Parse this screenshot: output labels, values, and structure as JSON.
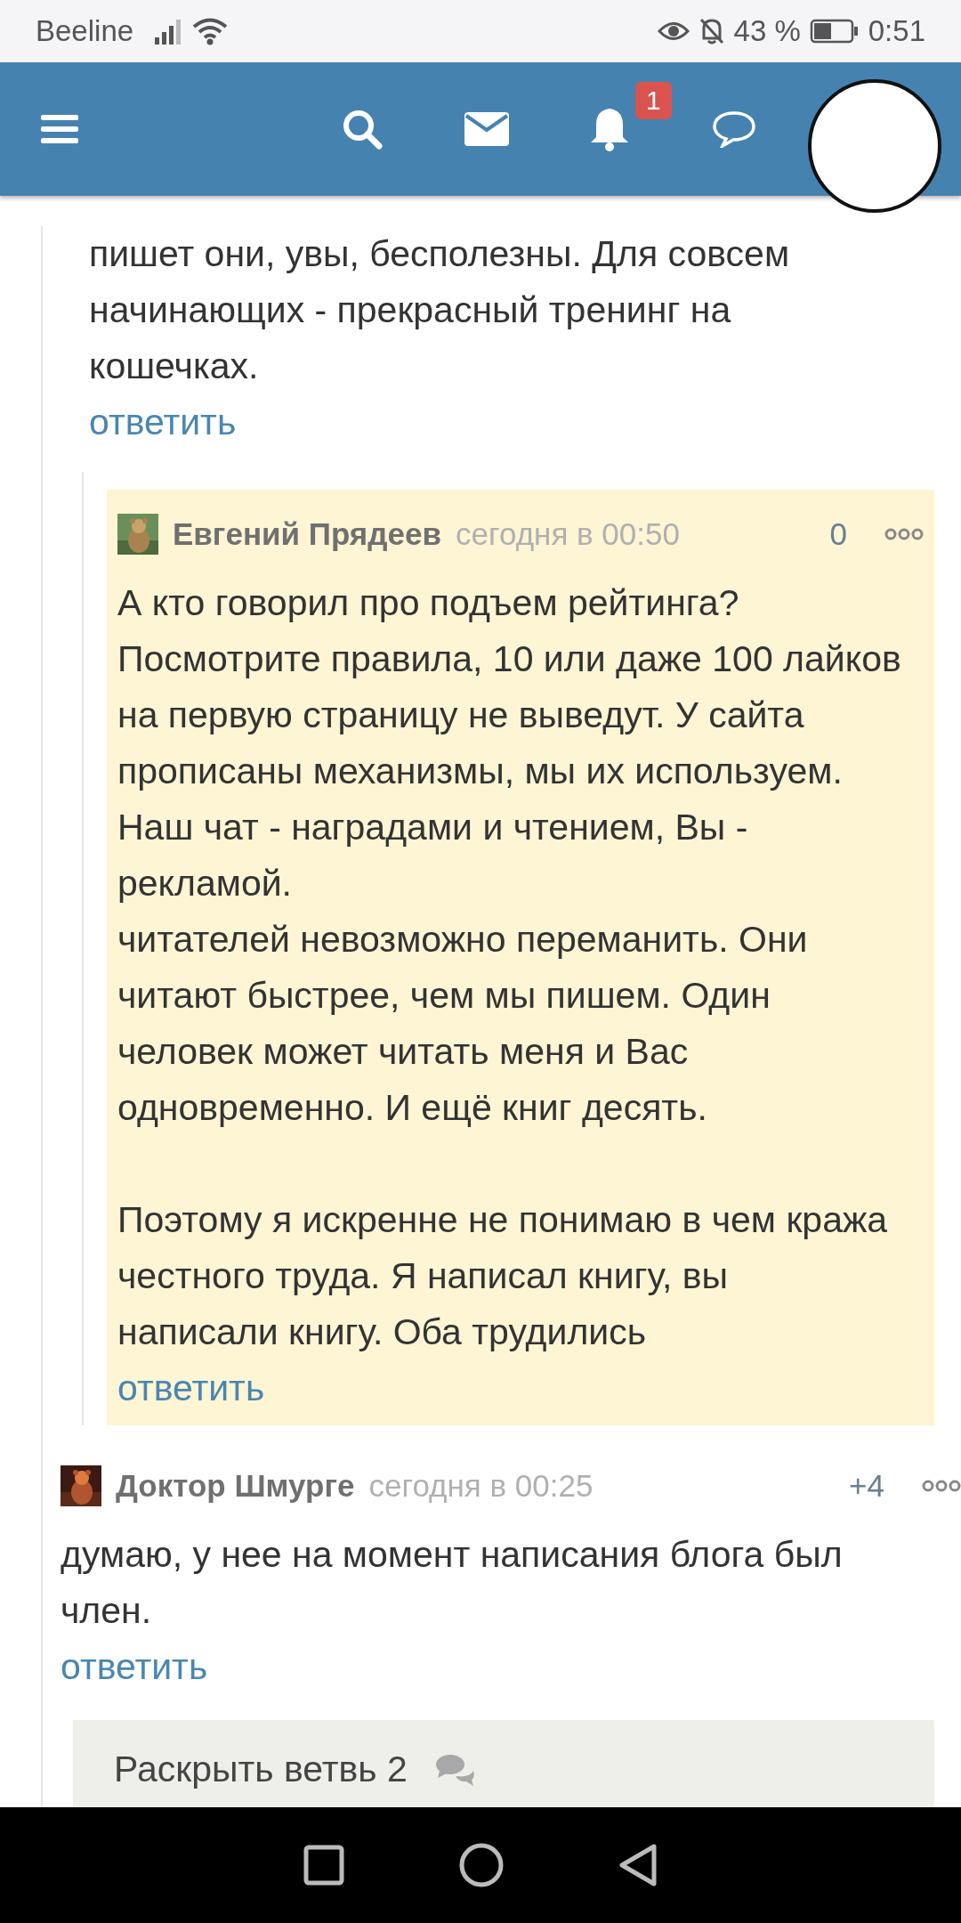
{
  "status_bar": {
    "carrier": "Beeline",
    "battery": "43 %",
    "time": "0:51"
  },
  "header": {
    "notification_count": "1"
  },
  "comments": [
    {
      "body": "пишет они, увы, бесполезны. Для совсем\nначинающих - прекрасный тренинг на\nкошечках.",
      "reply": "ответить",
      "highlighted": false,
      "children": [
        {
          "author": "Евгений Прядеев",
          "time": "сегодня в 00:50",
          "score": "0",
          "body": "А кто говорил про подъем рейтинга?\nПосмотрите правила, 10 или даже 100 лайков\nна первую страницу не выведут. У сайта\nпрописаны механизмы, мы их используем.\nНаш чат - наградами и чтением, Вы -\nрекламой.\nчитателей невозможно переманить. Они\nчитают быстрее, чем мы пишем. Один\nчеловек может читать меня и Вас\nодновременно. И ещё книг десять.\n\nПоэтому я искренне не понимаю в чем кража\nчестного труда. Я написал книгу, вы\nнаписали книгу. Оба трудились",
          "reply": "ответить",
          "highlighted": true
        }
      ]
    },
    {
      "author": "Доктор Шмурге",
      "time": "сегодня в 00:25",
      "score": "+4",
      "body": "думаю, у нее на момент написания блога был\nчлен.",
      "reply": "ответить",
      "highlighted": false
    }
  ],
  "expand_thread": {
    "label": "Раскрыть ветвь 2"
  }
}
